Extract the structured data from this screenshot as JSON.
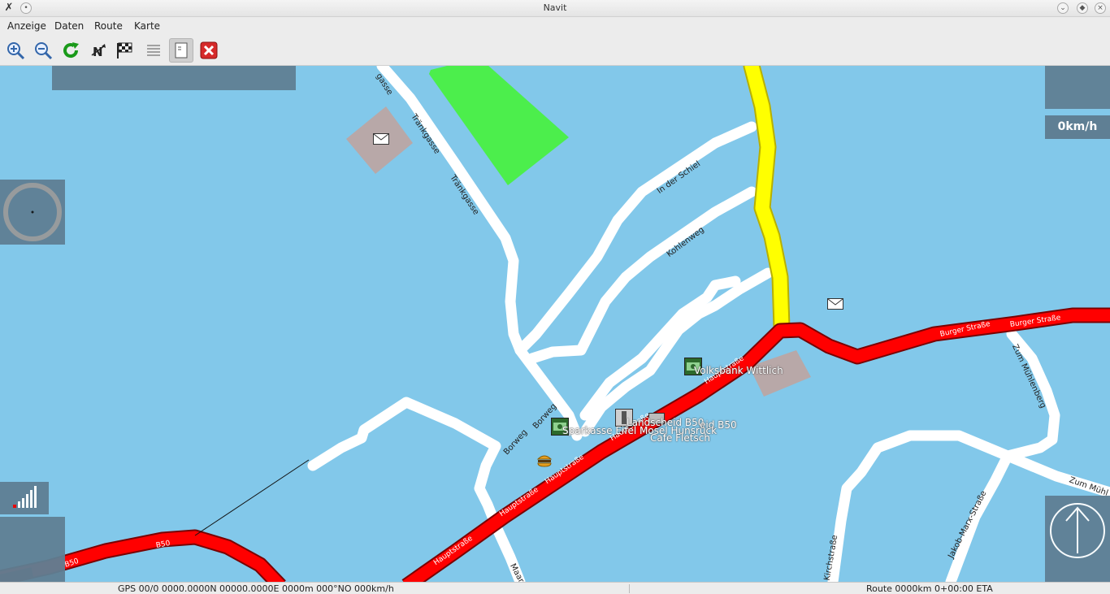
{
  "window": {
    "title": "Navit"
  },
  "menu": {
    "items": [
      "Anzeige",
      "Daten",
      "Route",
      "Karte"
    ]
  },
  "toolbar": {
    "tools": [
      {
        "name": "zoom-in-icon",
        "active": false
      },
      {
        "name": "zoom-out-icon",
        "active": false
      },
      {
        "name": "refresh-icon",
        "active": false
      },
      {
        "name": "north-orientation-icon",
        "active": false
      },
      {
        "name": "destination-flag-icon",
        "active": false
      },
      {
        "name": "list-icon",
        "active": false
      },
      {
        "name": "roadbook-icon",
        "active": true
      },
      {
        "name": "quit-icon",
        "active": false
      }
    ]
  },
  "map": {
    "speed": "0km/h",
    "road_labels": {
      "traenkgasse1": "Tränkgasse",
      "traenkgasse2": "Tränkgasse",
      "gasse_top": "gasse",
      "in_der_schiel": "In der Schiel",
      "kohlenweg": "Kohlenweg",
      "borweg1": "Borweg",
      "borweg2": "Borweg",
      "zum_muehlenberg": "Zum Mühlenberg",
      "zum_muehl": "Zum Mühl",
      "jakob_marx": "Jakob-Marx-Straße",
      "kirchstrasse": "Kirchstraße",
      "maarstr": "Maarstr",
      "b50_1": "B50",
      "b50_2": "B50",
      "burger1": "Burger Straße",
      "burger2": "Burger Straße",
      "haupt1": "Hauptstraße",
      "haupt2": "Hauptstraße",
      "haupt3": "Hauptstraße",
      "haupt4": "Hauptstraße",
      "haupt5": "Hauptstraße"
    },
    "pois": {
      "volksbank": "Volksbank Wittlich",
      "landscheid": "Landscheid B50",
      "sparkasse": "Sparkasse Eifel Mosel Hunsrück",
      "cafe": "Cafe Fletsch",
      "b50_overlap": "eid B50"
    }
  },
  "status": {
    "gps": "GPS 00/0 0000.0000N 00000.0000E 0000m 000°NO 000km/h",
    "route": "Route 0000km 0+00:00 ETA"
  },
  "colors": {
    "water": "#82c8ea",
    "main_road": "#ff0000",
    "trunk_road": "#ffff00",
    "overlay": "#5f7f94"
  }
}
